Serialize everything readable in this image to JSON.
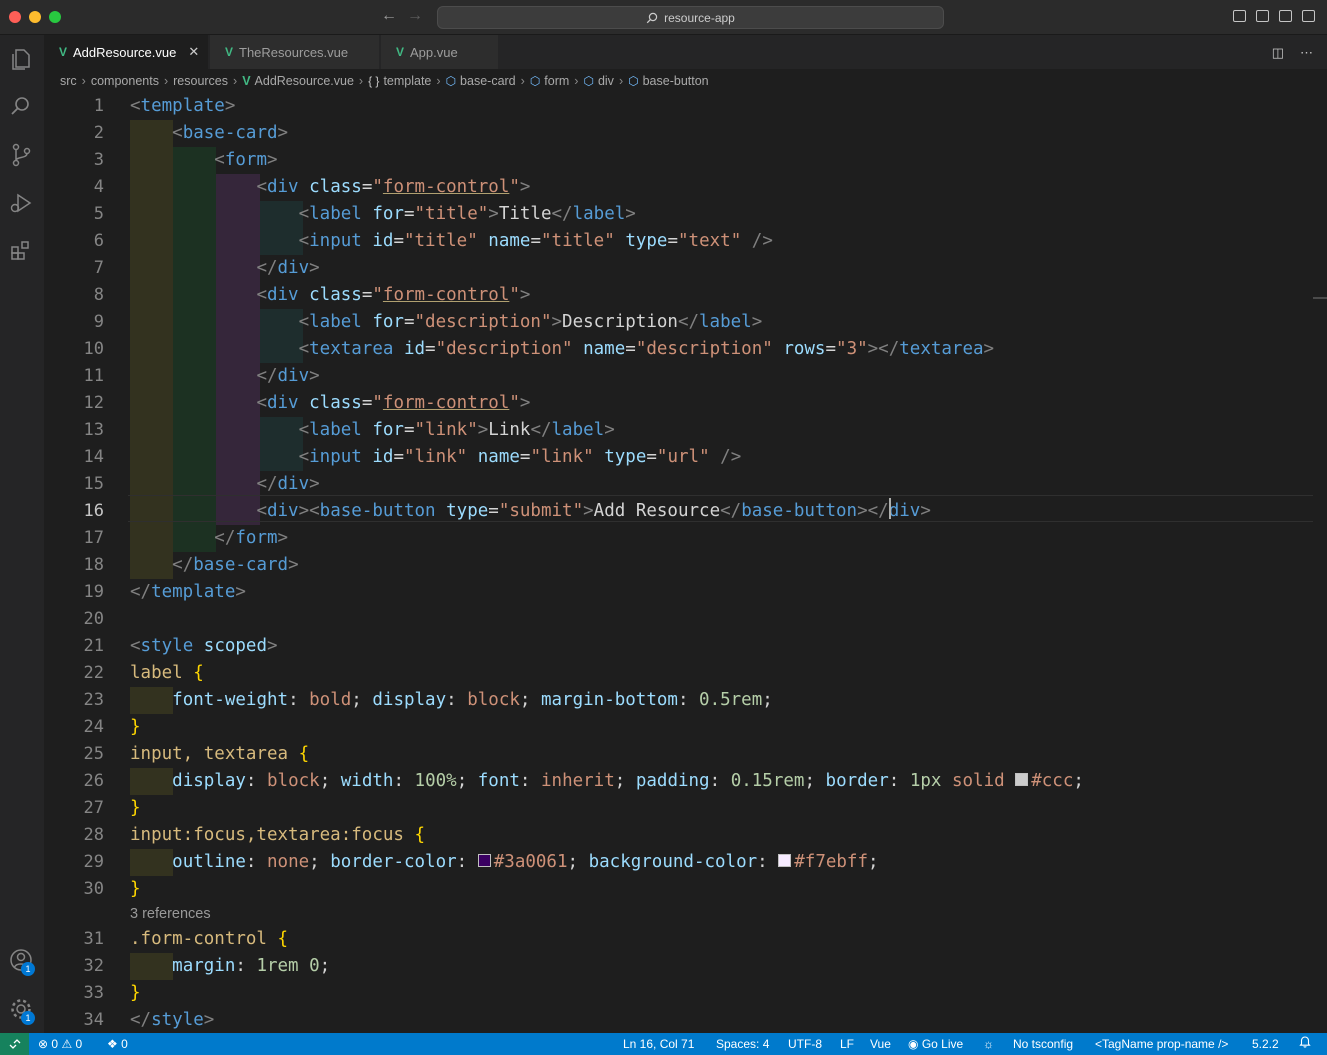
{
  "window": {
    "search_text": "resource-app"
  },
  "tabs": [
    {
      "label": "AddResource.vue",
      "active": true
    },
    {
      "label": "TheResources.vue",
      "active": false
    },
    {
      "label": "App.vue",
      "active": false
    }
  ],
  "breadcrumb": [
    "src",
    "components",
    "resources",
    "AddResource.vue",
    "template",
    "base-card",
    "form",
    "div",
    "base-button"
  ],
  "editor": {
    "current_line": 16,
    "line_numbers": [
      "1",
      "2",
      "3",
      "4",
      "5",
      "6",
      "7",
      "8",
      "9",
      "10",
      "11",
      "12",
      "13",
      "14",
      "15",
      "16",
      "17",
      "18",
      "19",
      "20",
      "21",
      "22",
      "23",
      "24",
      "25",
      "26",
      "27",
      "28",
      "29",
      "30",
      "31",
      "32",
      "33",
      "34"
    ],
    "codelens": "3 references",
    "lines": {
      "l1": {
        "p1": "<",
        "t1": "template",
        "p2": ">"
      },
      "l2": {
        "p1": "<",
        "t1": "base-card",
        "p2": ">"
      },
      "l3": {
        "p1": "<",
        "t1": "form",
        "p2": ">"
      },
      "l4": {
        "p1": "<",
        "t1": "div",
        "a1": "class",
        "eq": "=",
        "q1": "\"",
        "s1": "form-control",
        "q2": "\"",
        "p2": ">"
      },
      "l5": {
        "p1": "<",
        "t1": "label",
        "a1": "for",
        "eq": "=",
        "s1": "\"title\"",
        "p2": ">",
        "x1": "Title",
        "p3": "</",
        "t2": "label",
        "p4": ">"
      },
      "l6": {
        "p1": "<",
        "t1": "input",
        "a1": "id",
        "e1": "=",
        "s1": "\"title\"",
        "a2": "name",
        "e2": "=",
        "s2": "\"title\"",
        "a3": "type",
        "e3": "=",
        "s3": "\"text\"",
        "p2": "/>"
      },
      "l7": {
        "p1": "</",
        "t1": "div",
        "p2": ">"
      },
      "l8": {
        "p1": "<",
        "t1": "div",
        "a1": "class",
        "eq": "=",
        "q1": "\"",
        "s1": "form-control",
        "q2": "\"",
        "p2": ">"
      },
      "l9": {
        "p1": "<",
        "t1": "label",
        "a1": "for",
        "eq": "=",
        "s1": "\"description\"",
        "p2": ">",
        "x1": "Description",
        "p3": "</",
        "t2": "label",
        "p4": ">"
      },
      "l10": {
        "p1": "<",
        "t1": "textarea",
        "a1": "id",
        "e1": "=",
        "s1": "\"description\"",
        "a2": "name",
        "e2": "=",
        "s2": "\"description\"",
        "a3": "rows",
        "e3": "=",
        "s3": "\"3\"",
        "p2": "></",
        "t2": "textarea",
        "p3": ">"
      },
      "l11": {
        "p1": "</",
        "t1": "div",
        "p2": ">"
      },
      "l12": {
        "p1": "<",
        "t1": "div",
        "a1": "class",
        "eq": "=",
        "q1": "\"",
        "s1": "form-control",
        "q2": "\"",
        "p2": ">"
      },
      "l13": {
        "p1": "<",
        "t1": "label",
        "a1": "for",
        "eq": "=",
        "s1": "\"link\"",
        "p2": ">",
        "x1": "Link",
        "p3": "</",
        "t2": "label",
        "p4": ">"
      },
      "l14": {
        "p1": "<",
        "t1": "input",
        "a1": "id",
        "e1": "=",
        "s1": "\"link\"",
        "a2": "name",
        "e2": "=",
        "s2": "\"link\"",
        "a3": "type",
        "e3": "=",
        "s3": "\"url\"",
        "p2": "/>"
      },
      "l15": {
        "p1": "</",
        "t1": "div",
        "p2": ">"
      },
      "l16": {
        "p1": "<",
        "t1": "div",
        "p2": "><",
        "t2": "base-button",
        "a1": "type",
        "eq": "=",
        "s1": "\"submit\"",
        "p3": ">",
        "x1": "Add Resource",
        "p4": "</",
        "t3": "base-button",
        "p5": "></",
        "t4": "div",
        "p6": ">"
      },
      "l17": {
        "p1": "</",
        "t1": "form",
        "p2": ">"
      },
      "l18": {
        "p1": "</",
        "t1": "base-card",
        "p2": ">"
      },
      "l19": {
        "p1": "</",
        "t1": "template",
        "p2": ">"
      },
      "l21": {
        "p1": "<",
        "t1": "style",
        "a1": "scoped",
        "p2": ">"
      },
      "l22": {
        "sel": "label",
        "b": "{"
      },
      "l23": {
        "k1": "font-weight",
        "v1": "bold",
        "k2": "display",
        "v2": "block",
        "k3": "margin-bottom",
        "n3": "0.5rem"
      },
      "l24": {
        "b": "}"
      },
      "l25": {
        "sel": "input, textarea",
        "b": "{"
      },
      "l26": {
        "k1": "display",
        "v1": "block",
        "k2": "width",
        "n2": "100%",
        "k3": "font",
        "v3": "inherit",
        "k4": "padding",
        "n4": "0.15rem",
        "k5": "border",
        "n5": "1px",
        "v5": "solid",
        "c5": "#ccc"
      },
      "l27": {
        "b": "}"
      },
      "l28": {
        "sel": "input:focus,textarea:focus",
        "b": "{"
      },
      "l29": {
        "k1": "outline",
        "v1": "none",
        "k2": "border-color",
        "c2": "#3a0061",
        "k3": "background-color",
        "c3": "#f7ebff"
      },
      "l30": {
        "b": "}"
      },
      "l31": {
        "sel": ".form-control",
        "b": "{"
      },
      "l32": {
        "k1": "margin",
        "n1": "1rem 0"
      },
      "l33": {
        "b": "}"
      },
      "l34": {
        "p1": "</",
        "t1": "style",
        "p2": ">"
      }
    }
  },
  "status": {
    "errors": "0",
    "warnings": "0",
    "ports": "0",
    "position": "Ln 16, Col 71",
    "spaces": "Spaces: 4",
    "encoding": "UTF-8",
    "eol": "LF",
    "language": "Vue",
    "go_live": "Go Live",
    "tsconfig": "No tsconfig",
    "tag_name": "<TagName prop-name />",
    "version": "5.2.2"
  },
  "activity": {
    "accounts_badge": "1",
    "manage_badge": "1"
  },
  "colors": {
    "swatch_ccc": "#cccccc",
    "swatch_3a0061": "#3a0061",
    "swatch_f7ebff": "#f7ebff",
    "accent": "#007acc"
  },
  "icons": [
    "explorer-icon",
    "search-icon",
    "source-control-icon",
    "run-debug-icon",
    "extensions-icon",
    "accounts-icon",
    "manage-gear-icon",
    "vue-file-icon",
    "split-editor-icon",
    "more-actions-icon"
  ]
}
